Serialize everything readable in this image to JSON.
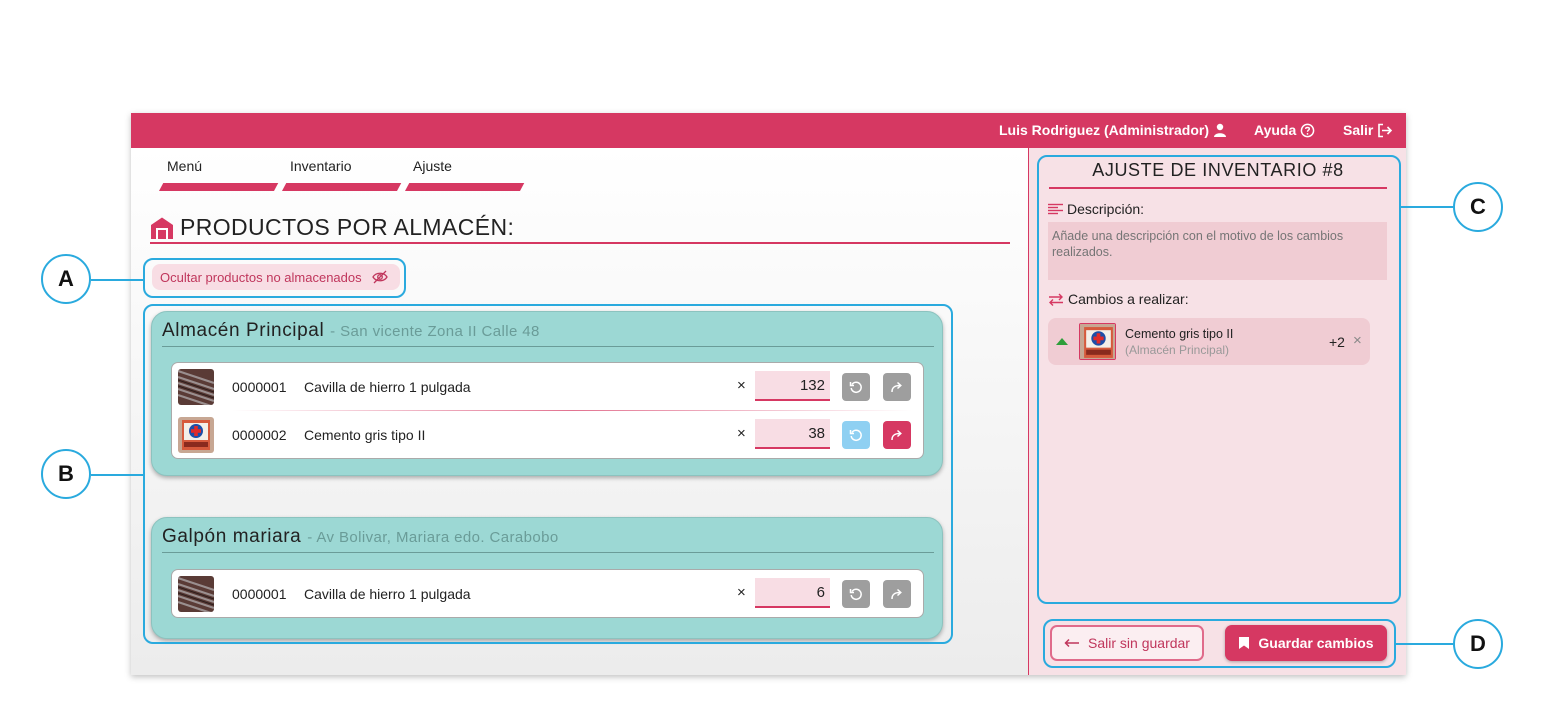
{
  "header": {
    "user": "Luis Rodriguez (Administrador)",
    "help": "Ayuda",
    "logout": "Salir"
  },
  "tabs": [
    {
      "label": "Menú"
    },
    {
      "label": "Inventario"
    },
    {
      "label": "Ajuste"
    }
  ],
  "page_title": "PRODUCTOS POR ALMACÉN:",
  "hide_button": "Ocultar productos no almacenados",
  "warehouses": [
    {
      "name": "Almacén Principal",
      "address": "- San vicente Zona II Calle 48",
      "products": [
        {
          "code": "0000001",
          "name": "Cavilla de hierro 1 pulgada",
          "times": "×",
          "qty": "132"
        },
        {
          "code": "0000002",
          "name": "Cemento gris tipo II",
          "times": "×",
          "qty": "38"
        }
      ]
    },
    {
      "name": "Galpón mariara",
      "address": "- Av Bolivar, Mariara edo. Carabobo",
      "products": [
        {
          "code": "0000001",
          "name": "Cavilla de hierro 1 pulgada",
          "times": "×",
          "qty": "6"
        }
      ]
    }
  ],
  "adjustment": {
    "title": "AJUSTE DE INVENTARIO #8",
    "description_label": "Descripción:",
    "description_placeholder": "Añade una descripción con el motivo de los cambios realizados.",
    "changes_label": "Cambios a realizar:",
    "changes": [
      {
        "name": "Cemento gris tipo II",
        "warehouse": "(Almacén Principal)",
        "qty": "+2",
        "remove": "×"
      }
    ],
    "exit_label": "Salir sin guardar",
    "save_label": "Guardar cambios"
  },
  "callouts": {
    "a": "A",
    "b": "B",
    "c": "C",
    "d": "D"
  },
  "colors": {
    "primary": "#d63862",
    "warehouse_bg": "#9cd8d4",
    "panel_bg": "#f7e1e6",
    "annotation": "#2aaade"
  }
}
